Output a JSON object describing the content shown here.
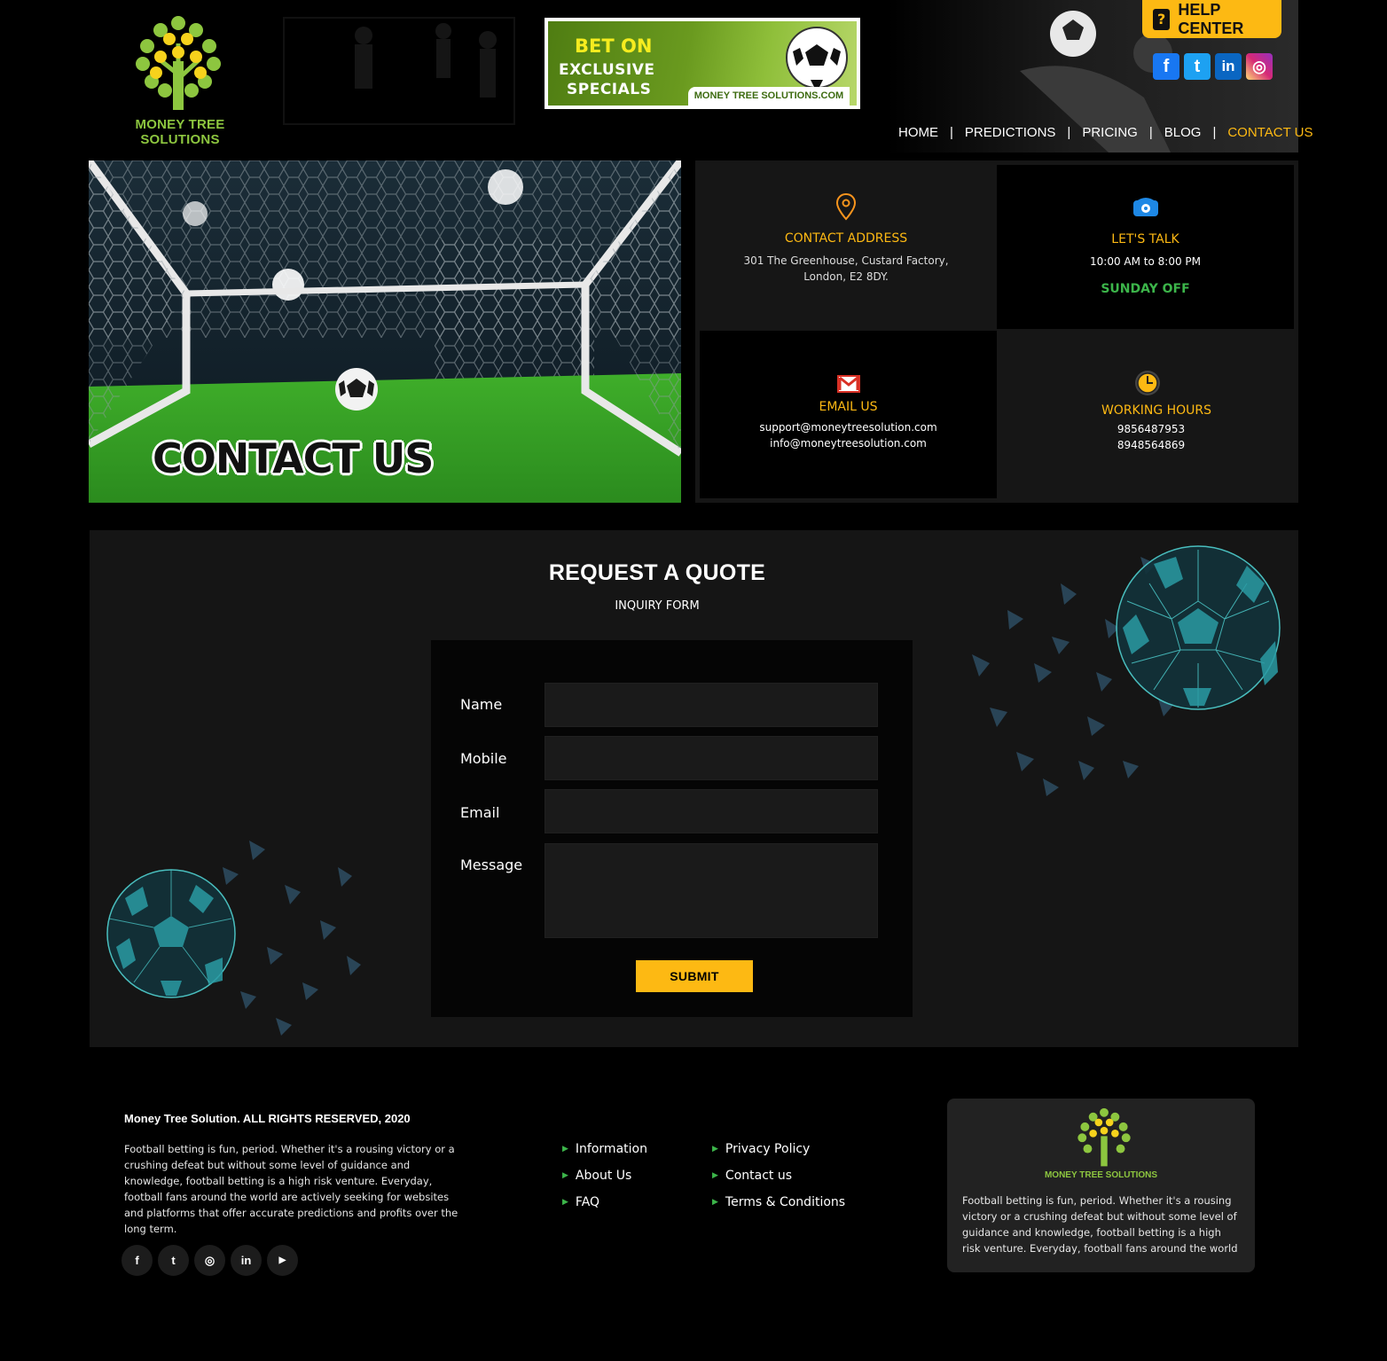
{
  "brand": {
    "logo_text": "MONEY TREE SOLUTIONS"
  },
  "ad": {
    "line1": "BET ON",
    "line2": "EXCLUSIVE",
    "line3": "SPECIALS",
    "url": "MONEY TREE SOLUTIONS.COM"
  },
  "help_center": {
    "icon": "?",
    "label": "HELP CENTER"
  },
  "header_social": [
    {
      "icon": "facebook-icon",
      "glyph": "f",
      "color": "#1877f2"
    },
    {
      "icon": "twitter-icon",
      "glyph": "t",
      "color": "#1da1f2"
    },
    {
      "icon": "linkedin-icon",
      "glyph": "in",
      "color": "#0a66c2"
    },
    {
      "icon": "instagram-icon",
      "glyph": "◎",
      "color": "#d62976"
    }
  ],
  "nav": {
    "items": [
      "HOME",
      "PREDICTIONS",
      "PRICING",
      "BLOG",
      "CONTACT US"
    ],
    "active": "CONTACT US"
  },
  "hero": {
    "caption": "CONTACT US"
  },
  "contact": {
    "address": {
      "title": "CONTACT ADDRESS",
      "line1": "301 The Greenhouse, Custard Factory,",
      "line2": "London, E2 8DY."
    },
    "talk": {
      "title": "LET'S TALK",
      "hours": "10:00 AM to 8:00 PM",
      "note": "SUNDAY OFF"
    },
    "email": {
      "title": "EMAIL US",
      "line1": "support@moneytreesolution.com",
      "line2": "info@moneytreesolution.com"
    },
    "working": {
      "title": "WORKING HOURS",
      "line1": "9856487953",
      "line2": "8948564869"
    }
  },
  "quote": {
    "title": "REQUEST A QUOTE",
    "subtitle": "INQUIRY FORM",
    "fields": {
      "name": "Name",
      "mobile": "Mobile",
      "email": "Email",
      "message": "Message"
    },
    "submit": "SUBMIT"
  },
  "footer": {
    "rights": "Money Tree Solution. ALL RIGHTS RESERVED, 2020",
    "description": "Football betting is fun, period. Whether it's a rousing victory or a crushing defeat but without some level of guidance and knowledge, football betting is a high risk venture. Everyday, football fans around the world are actively seeking for websites and platforms that offer accurate predictions and profits over the long term.",
    "social": [
      {
        "icon": "facebook-icon",
        "glyph": "f"
      },
      {
        "icon": "twitter-icon",
        "glyph": "t"
      },
      {
        "icon": "instagram-icon",
        "glyph": "◎"
      },
      {
        "icon": "linkedin-icon",
        "glyph": "in"
      },
      {
        "icon": "youtube-icon",
        "glyph": "▶"
      }
    ],
    "links_col1": [
      "Information",
      "About Us",
      "FAQ"
    ],
    "links_col2": [
      "Privacy Policy",
      "Contact us",
      "Terms & Conditions"
    ],
    "card_logo_text": "MONEY TREE SOLUTIONS",
    "card_text": "Football betting is fun, period. Whether it's a rousing victory or a crushing defeat but without some level of guidance and knowledge, football betting is a high risk venture. Everyday, football fans around the world"
  },
  "colors": {
    "accent": "#fdb913",
    "green": "#3cb54a",
    "logo_green": "#8dc63f"
  }
}
